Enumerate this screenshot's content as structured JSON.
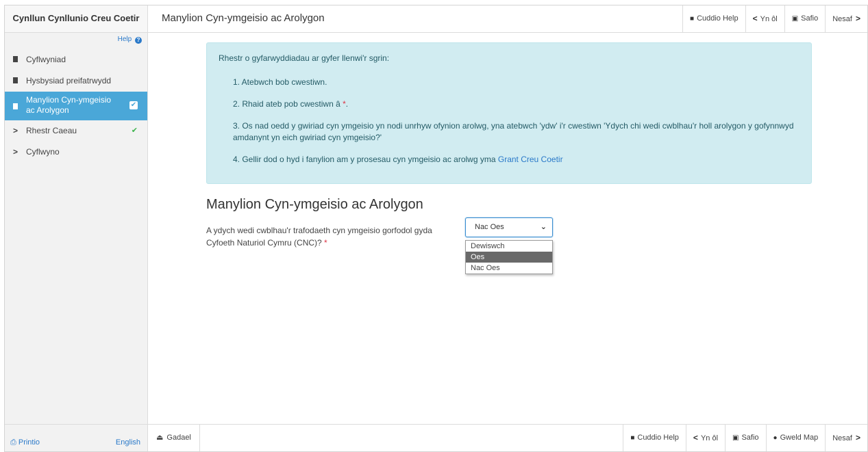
{
  "sidebar": {
    "title": "Cynllun Cynllunio Creu Coetir",
    "help_label": "Help",
    "items": [
      {
        "label": "Cyflwyniad"
      },
      {
        "label": "Hysbysiad preifatrwydd"
      },
      {
        "label": "Manylion Cyn-ymgeisio ac Arolygon"
      },
      {
        "label": "Rhestr Caeau"
      },
      {
        "label": "Cyflwyno"
      }
    ],
    "print_label": "Printio",
    "language_label": "English"
  },
  "topbar": {
    "page_title": "Manylion Cyn-ymgeisio ac Arolygon",
    "hide_help_label": "Cuddio Help",
    "back_label": "Yn ôl",
    "save_label": "Safio",
    "next_label": "Nesaf"
  },
  "info": {
    "intro": "Rhestr o gyfarwyddiadau ar gyfer llenwi'r sgrin:",
    "item1": "1. Atebwch bob cwestiwn.",
    "item2_text": "2. Rhaid ateb pob cwestiwn â",
    "item2_marker": "*",
    "item2_end": ".",
    "item3": "3. Os nad oedd y gwiriad cyn ymgeisio yn nodi unrhyw ofynion arolwg, yna atebwch 'ydw' i'r cwestiwn 'Ydych chi wedi cwblhau'r holl arolygon y gofynnwyd amdanynt yn eich gwiriad cyn ymgeisio?'",
    "item4_text": "4. Gellir dod o hyd i fanylion am y prosesau cyn ymgeisio ac arolwg yma",
    "item4_link": "Grant Creu Coetir"
  },
  "form": {
    "section_title": "Manylion Cyn-ymgeisio ac Arolygon",
    "question": "A ydych wedi cwblhau'r trafodaeth cyn ymgeisio gorfodol gyda Cyfoeth Naturiol Cymru (CNC)?",
    "required_marker": "*",
    "select_value": "Nac Oes",
    "options": [
      "Dewiswch",
      "Oes",
      "Nac Oes"
    ],
    "highlighted_option": "Oes"
  },
  "bottombar": {
    "exit_label": "Gadael",
    "hide_help_label": "Cuddio Help",
    "back_label": "Yn ôl",
    "save_label": "Safio",
    "map_label": "Gweld Map",
    "next_label": "Nesaf"
  },
  "colors": {
    "accent": "#4aa7d8",
    "link": "#2a79c9",
    "info_bg": "#d1ecf1",
    "success": "#3db34d",
    "required": "#dc3545"
  }
}
